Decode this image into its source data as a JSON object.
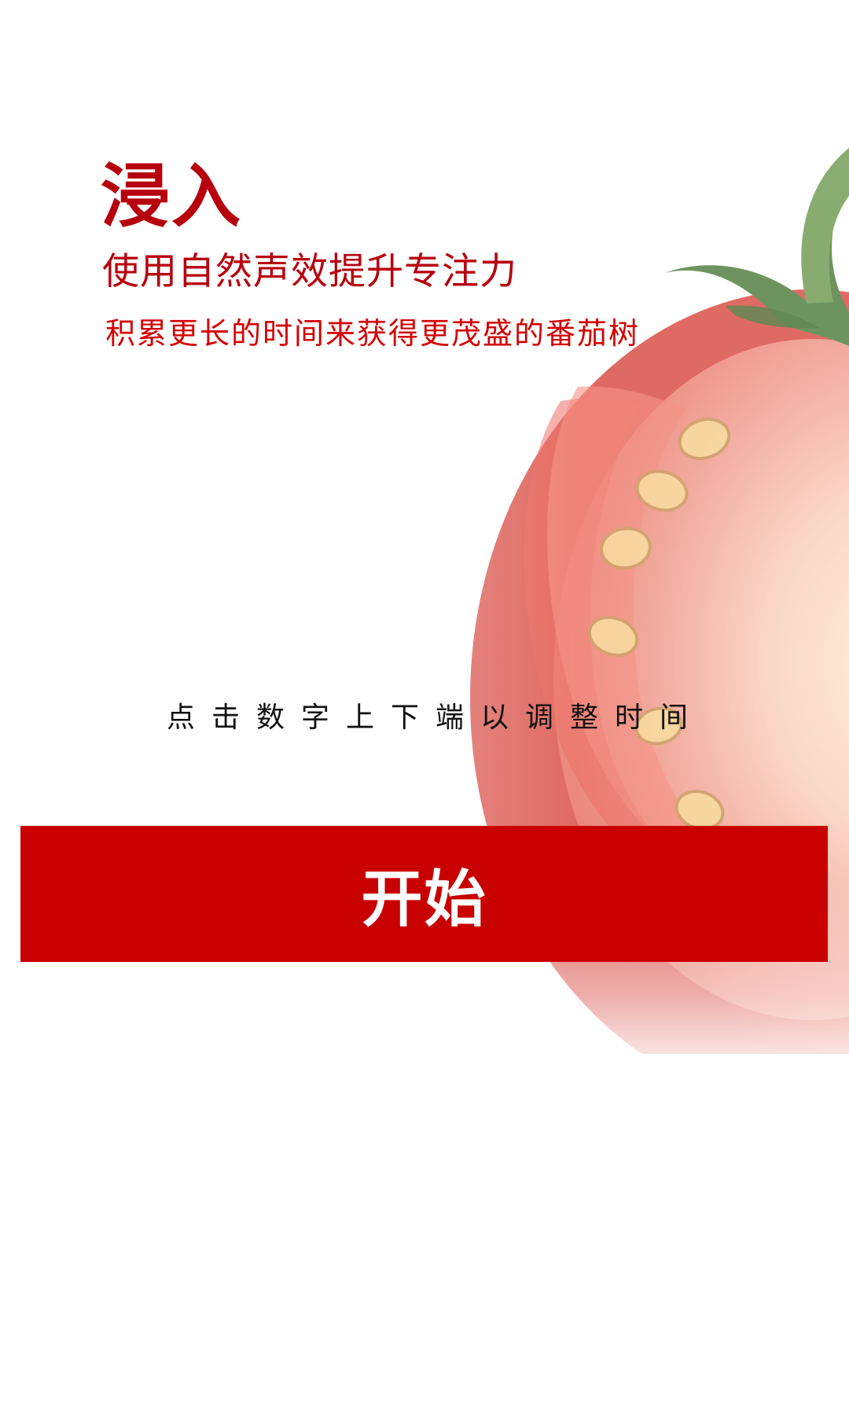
{
  "screen": {
    "title": "浸入",
    "subtitle": "使用自然声效提升专注力",
    "tagline": "积累更长的时间来获得更茂盛的番茄树",
    "hint": "点击数字上下端以调整时间"
  },
  "actions": {
    "start_label": "开始"
  },
  "theme": {
    "background": "#ffffff",
    "accent": "#c90000",
    "text_red": "#b7000d",
    "hint_text": "#111111",
    "tomato": "#f36b5b"
  },
  "illustration": {
    "name": "tomato-half-illustration"
  }
}
